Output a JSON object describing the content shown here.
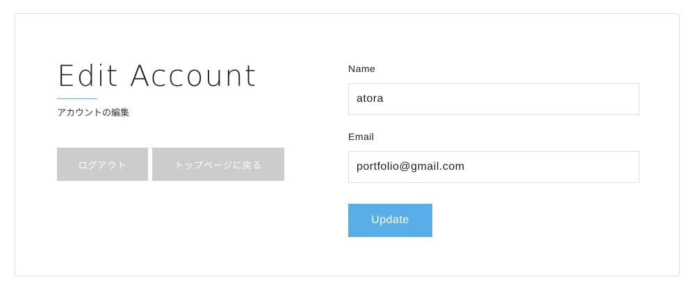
{
  "page": {
    "title": "Edit Account",
    "subtitle": "アカウントの編集"
  },
  "actions": {
    "logout_label": "ログアウト",
    "back_to_top_label": "トップページに戻る"
  },
  "form": {
    "name_label": "Name",
    "name_value": "atora",
    "email_label": "Email",
    "email_value": "portfolio@gmail.com",
    "submit_label": "Update"
  },
  "colors": {
    "accent": "#5aaee8",
    "secondary_button": "#cccccc",
    "underline": "#5aa9e6",
    "border": "#dcdcdc"
  }
}
